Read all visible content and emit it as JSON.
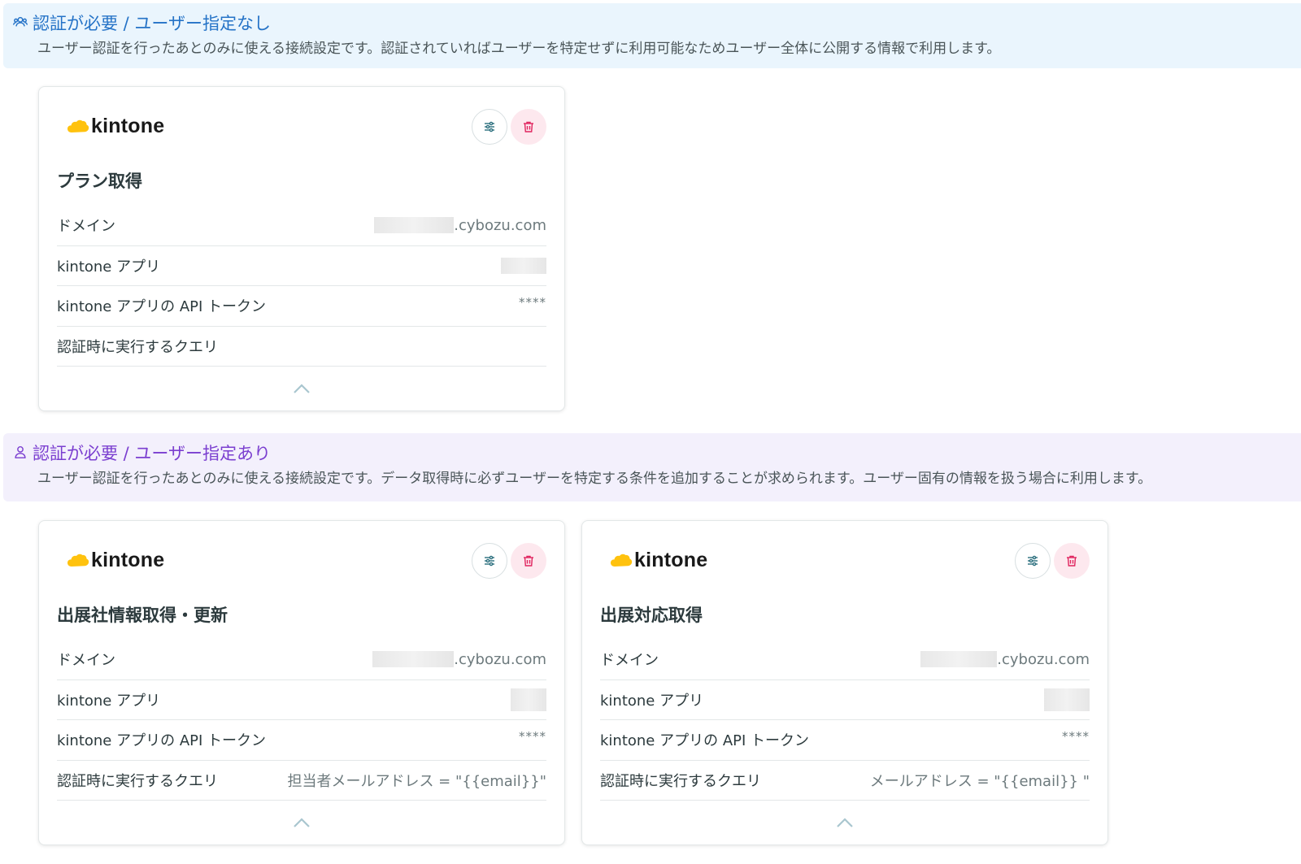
{
  "colors": {
    "section1_title": "#2573c7",
    "section1_bg": "#eaf5fd",
    "section2_title": "#7b3fd0",
    "section2_bg": "#f3f0fc",
    "delete_bg": "#fde8ee",
    "delete_icon": "#e0245e",
    "kintone_yellow": "#ffc20e"
  },
  "section1": {
    "icon": "users-icon",
    "title": "認証が必要 / ユーザー指定なし",
    "description": "ユーザー認証を行ったあとのみに使える接続設定です。認証されていればユーザーを特定せずに利用可能なためユーザー全体に公開する情報で利用します。"
  },
  "section2": {
    "icon": "user-icon",
    "title": "認証が必要 / ユーザー指定あり",
    "description": "ユーザー認証を行ったあとのみに使える接続設定です。データ取得時に必ずユーザーを特定する条件を追加することが求められます。ユーザー固有の情報を扱う場合に利用します。"
  },
  "cards": [
    {
      "logo": "kintone",
      "title": "プラン取得",
      "rows": [
        {
          "label": "ドメイン",
          "value": ".cybozu.com"
        },
        {
          "label": "kintone アプリ",
          "value": ""
        },
        {
          "label": "kintone アプリの API トークン",
          "value": "****"
        },
        {
          "label": "認証時に実行するクエリ",
          "value": ""
        }
      ]
    },
    {
      "logo": "kintone",
      "title": "出展社情報取得・更新",
      "rows": [
        {
          "label": "ドメイン",
          "value": ".cybozu.com"
        },
        {
          "label": "kintone アプリ",
          "value": ""
        },
        {
          "label": "kintone アプリの API トークン",
          "value": "****"
        },
        {
          "label": "認証時に実行するクエリ",
          "value": "担当者メールアドレス = \"{{email}}\""
        }
      ]
    },
    {
      "logo": "kintone",
      "title": "出展対応取得",
      "rows": [
        {
          "label": "ドメイン",
          "value": ".cybozu.com"
        },
        {
          "label": "kintone アプリ",
          "value": ""
        },
        {
          "label": "kintone アプリの API トークン",
          "value": "****"
        },
        {
          "label": "認証時に実行するクエリ",
          "value": "メールアドレス = \"{{email}} \""
        }
      ]
    }
  ]
}
